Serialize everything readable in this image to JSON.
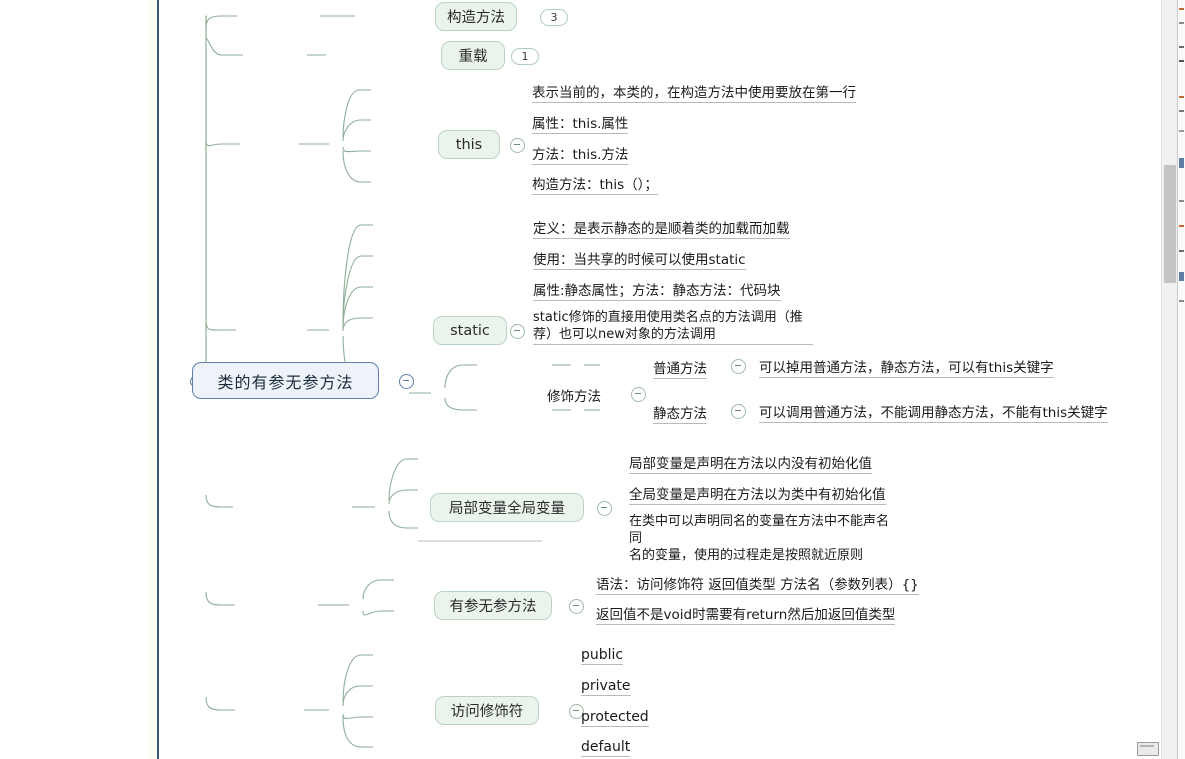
{
  "root": {
    "label": "类的有参无参方法"
  },
  "branches": [
    {
      "id": "constructor",
      "label": "构造方法",
      "badge": "3"
    },
    {
      "id": "overload",
      "label": "重载",
      "badge": "1"
    },
    {
      "id": "this",
      "label": "this",
      "children": [
        {
          "text": "表示当前的，本类的，在构造方法中使用要放在第一行"
        },
        {
          "text": "属性：this.属性"
        },
        {
          "text": "方法：this.方法"
        },
        {
          "text": "构造方法：this（）；"
        }
      ]
    },
    {
      "id": "static",
      "label": "static",
      "children": [
        {
          "text": "定义：是表示静态的是顺着类的加载而加载"
        },
        {
          "text": "使用：当共享的时候可以使用static"
        },
        {
          "text": "属性:静态属性；方法：静态方法：代码块"
        },
        {
          "text": "static修饰的直接用使用类名点的方法调用（推\n荐）也可以new对象的方法调用"
        },
        {
          "text": "修饰方法",
          "children": [
            {
              "text": "普通方法",
              "children": [
                {
                  "text": "可以掉用普通方法，静态方法，可以有this关键字"
                }
              ]
            },
            {
              "text": "静态方法",
              "children": [
                {
                  "text": "可以调用普通方法，不能调用静态方法，不能有this关键字"
                }
              ]
            }
          ]
        }
      ]
    },
    {
      "id": "variables",
      "label": "局部变量全局变量",
      "children": [
        {
          "text": "局部变量是声明在方法以内没有初始化值"
        },
        {
          "text": "全局变量是声明在方法以为类中有初始化值"
        },
        {
          "text": "在类中可以声明同名的变量在方法中不能声名同\n名的变量，使用的过程走是按照就近原则"
        }
      ]
    },
    {
      "id": "methods",
      "label": "有参无参方法",
      "children": [
        {
          "text": "语法：访问修饰符  返回值类型   方法名（参数列表）{}"
        },
        {
          "text": "返回值不是void时需要有return然后加返回值类型"
        }
      ]
    },
    {
      "id": "modifiers",
      "label": "访问修饰符",
      "children": [
        {
          "text": "public"
        },
        {
          "text": "private"
        },
        {
          "text": "protected"
        },
        {
          "text": "default"
        }
      ]
    }
  ],
  "colors": {
    "node_green_fill": "#eaf4ec",
    "node_green_border": "#bcd3c2",
    "root_fill": "#eef3fa",
    "root_border": "#5f7fa6",
    "link": "#8fae98",
    "spine": "#3c5a74",
    "text": "#1a1a1a"
  }
}
